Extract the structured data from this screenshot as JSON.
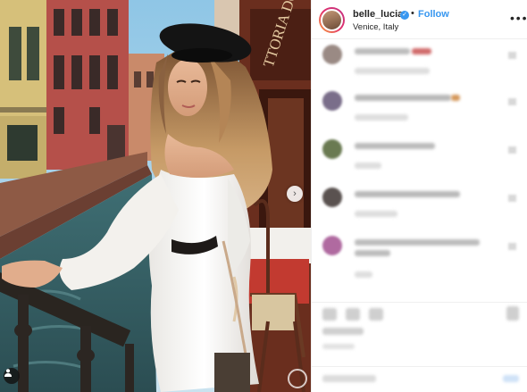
{
  "post": {
    "username": "belle_lucia",
    "verified_mark": "✓",
    "separator": "•",
    "follow_label": "Follow",
    "location": "Venice, Italy",
    "more_glyph": "• • •"
  },
  "media": {
    "next_glyph": "›",
    "icons": [
      "chevron-right-icon",
      "user-tag-icon"
    ],
    "shop_sign_text": "TTORIA DO"
  },
  "colors": {
    "accent_blue": "#3897f0",
    "text": "#262626",
    "border": "#efefef"
  }
}
